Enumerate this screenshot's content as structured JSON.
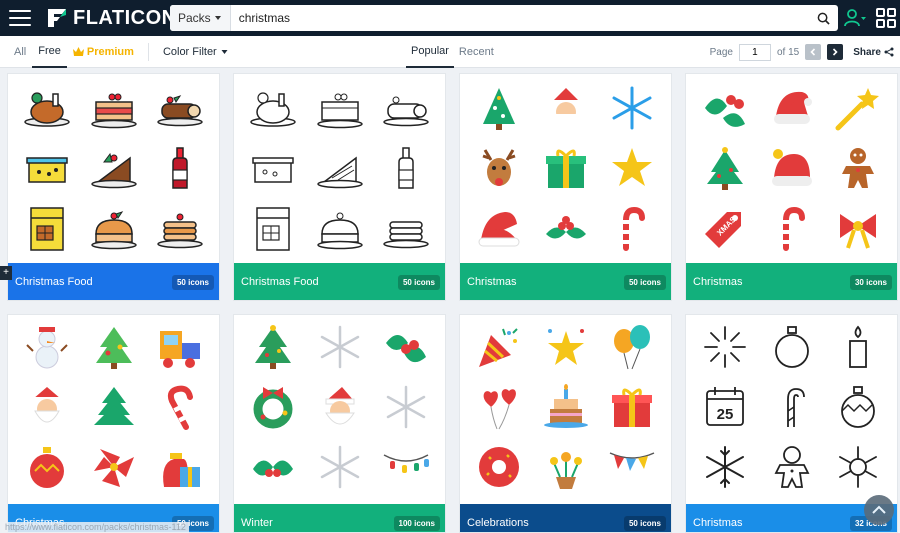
{
  "header": {
    "logo_text": "FLATICON",
    "search_category": "Packs",
    "search_value": "christmas"
  },
  "filters": {
    "all": "All",
    "free": "Free",
    "premium": "Premium",
    "color_filter": "Color Filter",
    "popular": "Popular",
    "recent": "Recent"
  },
  "pager": {
    "page_label": "Page",
    "page_value": "1",
    "of_label": "of 15",
    "share": "Share"
  },
  "packs": [
    {
      "title": "Christmas Food",
      "count": "50 icons",
      "color": "#1a73e8"
    },
    {
      "title": "Christmas Food",
      "count": "50 icons",
      "color": "#12b07c"
    },
    {
      "title": "Christmas",
      "count": "50 icons",
      "color": "#12b07c"
    },
    {
      "title": "Christmas",
      "count": "30 icons",
      "color": "#12b07c"
    },
    {
      "title": "Christmas",
      "count": "50 icons",
      "color": "#1a8ee8"
    },
    {
      "title": "Winter",
      "count": "100 icons",
      "color": "#12b07c"
    },
    {
      "title": "Celebrations",
      "count": "50 icons",
      "color": "#0b4c8c"
    },
    {
      "title": "Christmas",
      "count": "32 icons",
      "color": "#1a8ee8"
    }
  ],
  "icon_labels": {
    "xmas_tag": "XMAS",
    "calendar_day": "25"
  },
  "status_url": "https://www.flaticon.com/packs/christmas-112"
}
